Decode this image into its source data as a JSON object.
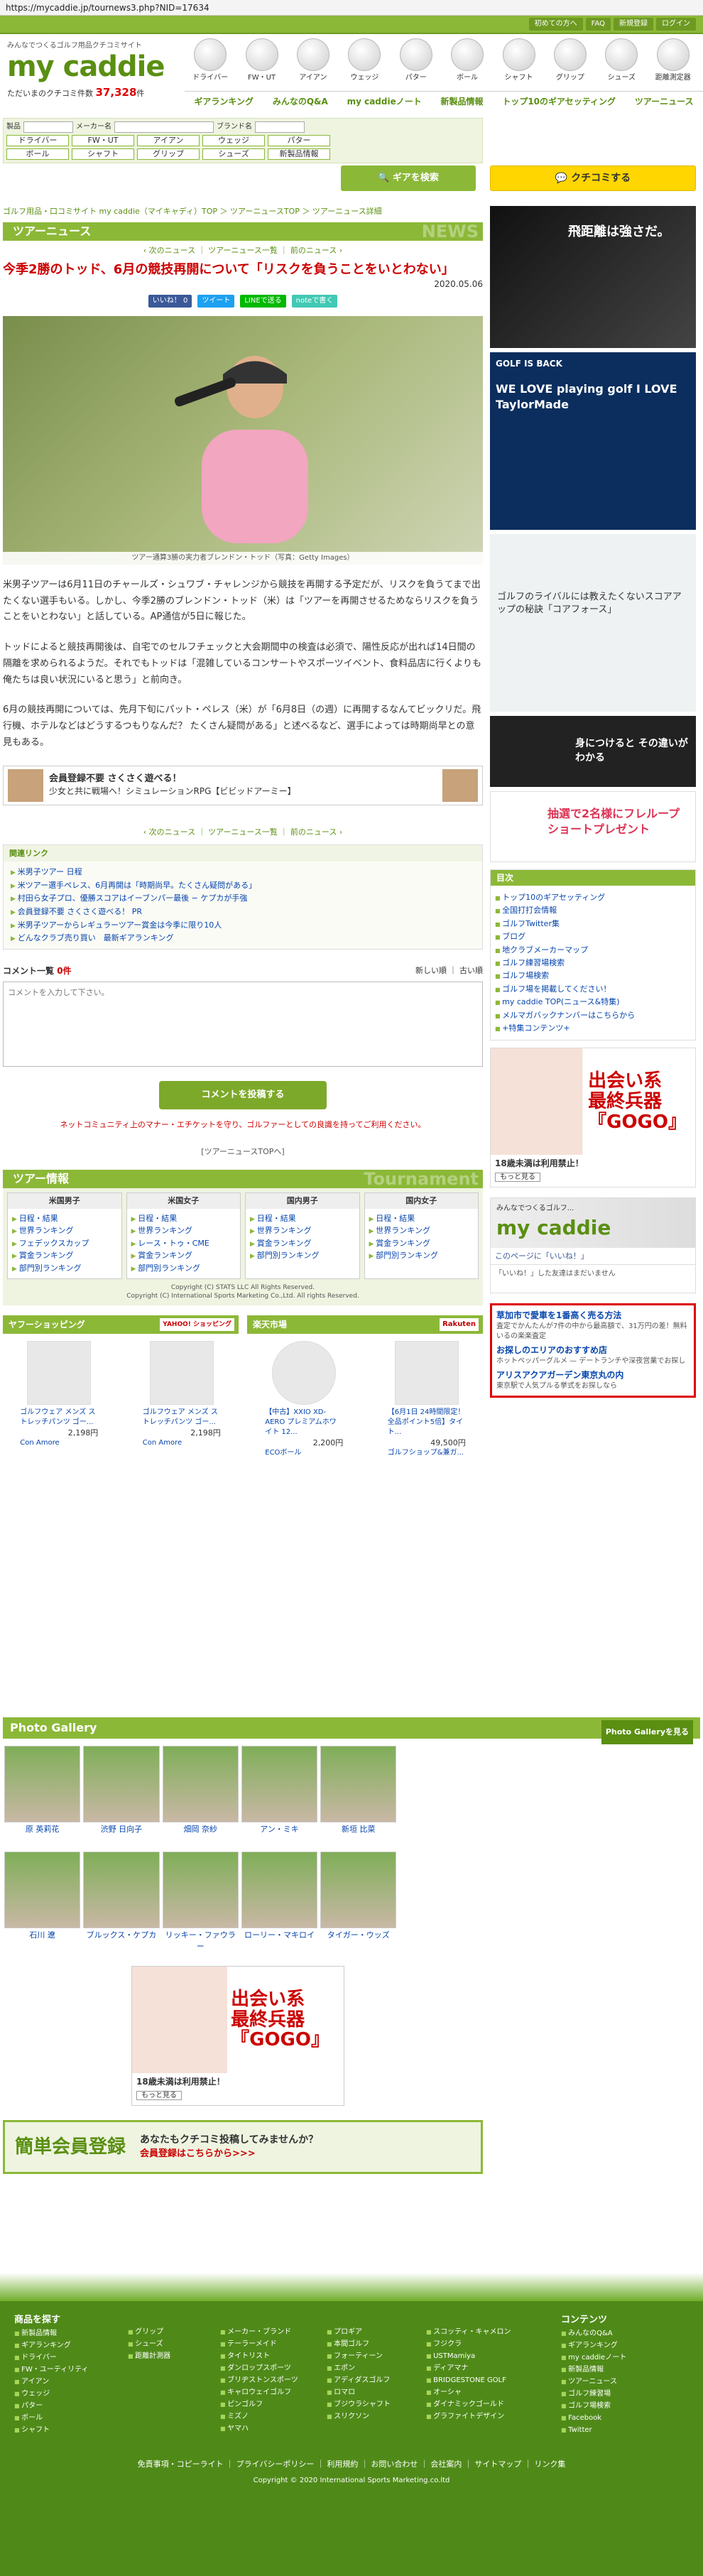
{
  "url": "https://mycaddie.jp/tournews3.php?NID=17634",
  "utility": [
    "初めての方へ",
    "FAQ",
    "新規登録",
    "ログイン"
  ],
  "logo": {
    "tagline": "みんなでつくるゴルフ用品クチコミサイト",
    "name": "my caddie",
    "count_label": "ただいまのクチコミ件数",
    "count_value": "37,328",
    "count_unit": "件"
  },
  "categories": [
    "ドライバー",
    "FW・UT",
    "アイアン",
    "ウェッジ",
    "パター",
    "ボール",
    "シャフト",
    "グリップ",
    "シューズ",
    "距離測定器"
  ],
  "main_nav": [
    "ギアランキング",
    "みんなのQ&A",
    "my caddieノート",
    "新製品情報",
    "トップ10のギアセッティング",
    "ツアーニュース"
  ],
  "search": {
    "labels": [
      "製品",
      "メーカー名",
      "ブランド名"
    ],
    "genres_row1": [
      "ドライバー",
      "FW・UT",
      "アイアン",
      "ウェッジ",
      "パター"
    ],
    "genres_row2": [
      "ボール",
      "シャフト",
      "グリップ",
      "シューズ",
      "新製品情報"
    ],
    "button": "ギアを検索",
    "kuchikomi_button": "クチコミする"
  },
  "breadcrumb": "ゴルフ用品・口コミサイト my caddie（マイキャディ）TOP ＞ ツアーニュースTOP ＞ ツアーニュース詳細",
  "section": {
    "title": "ツアーニュース",
    "bg": "NEWS"
  },
  "pager": {
    "prev": "次のニュース",
    "list": "ツアーニュース一覧",
    "next": "前のニュース"
  },
  "article": {
    "title": "今季2勝のトッド、6月の競技再開について「リスクを負うことをいとわない」",
    "date": "2020.05.06",
    "share": [
      "いいね！ 0",
      "ツイート",
      "LINEで送る",
      "noteで書く"
    ],
    "caption": "ツアー通算3勝の実力者ブレンドン・トッド（写真：Getty Images）",
    "paragraphs": [
      "米男子ツアーは6月11日のチャールズ・シュワブ・チャレンジから競技を再開する予定だが、リスクを負うてまで出たくない選手もいる。しかし、今季2勝のブレンドン・トッド（米）は「ツアーを再開させるためならリスクを負うことをいとわない」と話している。AP通信が5日に報じた。",
      "トッドによると競技再開後は、自宅でのセルフチェックと大会期間中の検査は必須で、陽性反応が出れば14日間の隔離を求められるようだ。それでもトッドは「混雑しているコンサートやスポーツイベント、食料品店に行くよりも俺たちは良い状況にいると思う」と前向き。",
      "6月の競技再開については、先月下旬にパット・ペレス（米）が「6月8日（の週）に再開するなんてビックリだ。飛行機、ホテルなどはどうするつもりなんだ？ たくさん疑問がある」と述べるなど、選手によっては時期尚早との意見もある。"
    ]
  },
  "ad_inline": {
    "title": "会員登録不要 さくさく遊べる！",
    "sub": "少女と共に戦場へ！シミュレーションRPG【ビビッドアーミー】"
  },
  "related": {
    "heading": "関連リンク",
    "links": [
      "米男子ツアー 日程",
      "米ツアー選手ペレス、6月再開は「時期尚早。たくさん疑問がある」",
      "村田ら女子プロ、優勝スコアはイーブンパー最後 − ケプカが手強",
      "会員登録不要 さくさく遊べる！ PR",
      "米男子ツアーからレギュラーツアー賞金は今季に限り10人",
      "どんなクラブ売り買い　最新ギアランキング"
    ]
  },
  "comments": {
    "heading": "コメント一覧",
    "count": "0件",
    "sort": [
      "新しい順",
      "古い順"
    ],
    "placeholder": "コメントを入力して下さい。",
    "post": "コメントを投稿する",
    "note": "ネットコミュニティ上のマナー・エチケットを守り、ゴルファーとしての良識を持ってご利用ください。",
    "back": "[ツアーニュースTOPへ]"
  },
  "tour_info": {
    "title": "ツアー情報",
    "bg": "Tournament",
    "cols": [
      {
        "head": "米国男子",
        "items": [
          "日程・結果",
          "世界ランキング",
          "フェデックスカップ",
          "賞金ランキング",
          "部門別ランキング"
        ]
      },
      {
        "head": "米国女子",
        "items": [
          "日程・結果",
          "世界ランキング",
          "レース・トゥ・CME",
          "賞金ランキング",
          "部門別ランキング"
        ]
      },
      {
        "head": "国内男子",
        "items": [
          "日程・結果",
          "世界ランキング",
          "賞金ランキング",
          "部門別ランキング"
        ]
      },
      {
        "head": "国内女子",
        "items": [
          "日程・結果",
          "世界ランキング",
          "賞金ランキング",
          "部門別ランキング"
        ]
      }
    ],
    "copyright1": "Copyright (C) STATS LLC All Rights Reserved.",
    "copyright2": "Copyright (C) International Sports Marketing Co.,Ltd. All rights Reserved."
  },
  "shopping": {
    "yahoo_label": "ヤフーショッピング",
    "yahoo_logo": "YAHOO! ショッピング",
    "rakuten_label": "楽天市場",
    "rakuten_logo": "Rakuten",
    "items": [
      {
        "title": "ゴルフウェア メンズ ストレッチパンツ ゴー...",
        "price": "2,198円",
        "shop": "Con Amore"
      },
      {
        "title": "ゴルフウェア メンズ ストレッチパンツ ゴー...",
        "price": "2,198円",
        "shop": "Con Amore"
      },
      {
        "title": "【中古】XXIO XD-AERO プレミアムホワイト 12...",
        "price": "2,200円",
        "shop": "ECOボール"
      },
      {
        "title": "【6月1日 24時間限定！全品ポイント5倍】タイト...",
        "price": "49,500円",
        "shop": "ゴルフショップ&兼ガ..."
      }
    ]
  },
  "gallery": {
    "title": "Photo Gallery",
    "more": "Photo Galleryを見る",
    "row1": [
      "原 英莉花",
      "渋野 日向子",
      "畑岡 奈紗",
      "アン・ミキ",
      "新垣 比菜",
      ""
    ],
    "row2": [
      "石川 遼",
      "ブルックス・ケプカ",
      "リッキー・ファウラー",
      "ローリー・マキロイ",
      "タイガー・ウッズ",
      ""
    ]
  },
  "ad_bottom": {
    "headline": "出会い系\n最終兵器\n『GOGO』",
    "note": "18歳未満は利用禁止！",
    "more": "もっと見る"
  },
  "register": {
    "left": "簡単会員登録",
    "right1": "あなたもクチコミ投稿してみませんか？",
    "right2": "会員登録はこちらから>>>"
  },
  "sidebar": {
    "banners": [
      "飛距離は強さだ。",
      "GOLF IS BACK",
      "WE LOVE playing golf I LOVE TaylorMade",
      "ゴルフのライバルには教えたくないスコアアップの秘訣「コアフォース」",
      "身につけると その違いがわかる",
      "抽選で2名様にフレループショートプレゼント"
    ],
    "menu_title": "目次",
    "menu": [
      "トップ10のギアセッティング",
      "全国打打会情報",
      "ゴルフTwitter集",
      "ブログ",
      "地クラブメーカーマップ",
      "ゴルフ練習場検索",
      "ゴルフ場検索",
      "ゴルフ場を掲載してください！",
      "my caddie TOP(ニュース&特集)",
      "メルマガバックナンバーはこちらから",
      "+特集コンテンツ+"
    ],
    "ad_headline": "出会い系\n最終兵器\n『GOGO』",
    "ad_note": "18歳未満は利用禁止！",
    "ad_more": "もっと見る",
    "fb_name": "my caddie",
    "fb_tag": "みんなでつくるゴルフ...",
    "fb_like": "このページに「いいね！」",
    "fb_box": "「いいね！」した友達はまだいません",
    "red_ad": [
      {
        "t": "草加市で愛車を1番高く売る方法",
        "d": "査定でかんたんが7件の中から最高額で、31万円の差！無料いるの楽楽査定"
      },
      {
        "t": "お探しのエリアのおすすめ店",
        "d": "ホットペッパーグルメ — デートランチや深夜営業でお探し"
      },
      {
        "t": "アリスアクアガーデン東京丸の内",
        "d": "東京駅で人気プルる挙式をお探しなら"
      }
    ]
  },
  "footer": {
    "products_title": "商品を探す",
    "contents_title": "コンテンツ",
    "col1": [
      "新製品情報",
      "ギアランキング",
      "ドライバー",
      "FW・ユーティリティ",
      "アイアン",
      "ウェッジ",
      "パター",
      "ボール",
      "シャフト"
    ],
    "col2": [
      "グリップ",
      "シューズ",
      "距離計測器"
    ],
    "col3": [
      "メーカー・ブランド",
      "テーラーメイド",
      "タイトリスト",
      "ダンロップスポーツ",
      "ブリヂストンスポーツ",
      "キャロウェイゴルフ",
      "ピンゴルフ",
      "ミズノ",
      "ヤマハ"
    ],
    "col4": [
      "プロギア",
      "本間ゴルフ",
      "フォーティーン",
      "エポン",
      "アディダスゴルフ",
      "ロマロ",
      "ブジウラシャフト",
      "スリクソン"
    ],
    "col5": [
      "スコッティ・キャメロン",
      "フジクラ",
      "USTMamiya",
      "ディアマナ",
      "BRIDGESTONE GOLF",
      "オーシャ",
      "ダイナミックゴールド",
      "グラファイトデザイン"
    ],
    "col6": [
      "みんなのQ&A",
      "ギアランキング",
      "my caddieノート",
      "新製品情報",
      "ツアーニュース",
      "ゴルフ練習場",
      "ゴルフ場検索",
      "Facebook",
      "Twitter"
    ],
    "bottom_links": [
      "免責事項・コピーライト",
      "プライバシーポリシー",
      "利用規約",
      "お問い合わせ",
      "会社案内",
      "サイトマップ",
      "リンク集"
    ],
    "copyright": "Copyright © 2020 International Sports Marketing.co.ltd"
  },
  "colors": {
    "brand": "#8cb838",
    "brand_dark": "#5a8f12",
    "accent": "#cc0000",
    "footer": "#4f8a19"
  }
}
